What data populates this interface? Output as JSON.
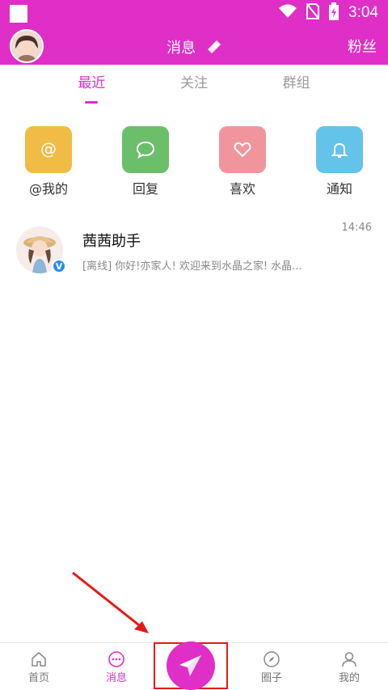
{
  "status": {
    "time": "3:04"
  },
  "header": {
    "title": "消息",
    "right_label": "粉丝"
  },
  "tabs": [
    {
      "label": "最近",
      "active": true
    },
    {
      "label": "关注",
      "active": false
    },
    {
      "label": "群组",
      "active": false
    }
  ],
  "quick_actions": [
    {
      "label": "@我的",
      "color": "#f0bc45",
      "icon": "at-icon"
    },
    {
      "label": "回复",
      "color": "#6cbf6a",
      "icon": "chat-bubble-icon"
    },
    {
      "label": "喜欢",
      "color": "#f0959c",
      "icon": "heart-icon"
    },
    {
      "label": "通知",
      "color": "#63c3e9",
      "icon": "bell-icon"
    }
  ],
  "chat": {
    "name": "茜茜助手",
    "preview": "[离线] 你好!亦家人! 欢迎来到水晶之家! 水晶...",
    "time": "14:46",
    "verified_mark": "V"
  },
  "bottom_nav": [
    {
      "label": "首页",
      "icon": "home-icon",
      "active": false
    },
    {
      "label": "消息",
      "icon": "message-icon",
      "active": true
    },
    {
      "label": "",
      "icon": "paper-plane-icon",
      "active": false
    },
    {
      "label": "圈子",
      "icon": "compass-icon",
      "active": false
    },
    {
      "label": "我的",
      "icon": "profile-icon",
      "active": false
    }
  ],
  "colors": {
    "accent": "#e02fc7",
    "highlight_box": "#e31a1a"
  }
}
